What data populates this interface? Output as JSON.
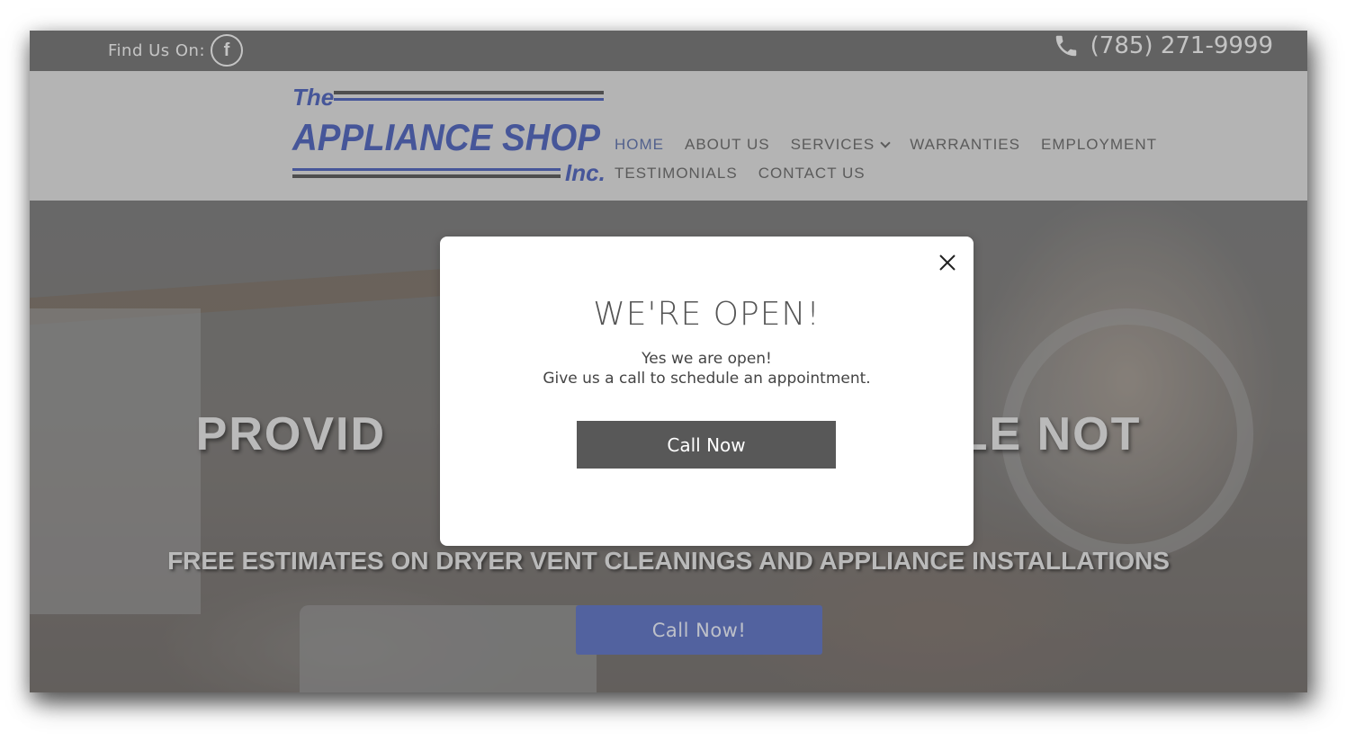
{
  "topbar": {
    "find_us_label": "Find Us On:",
    "facebook_glyph": "f",
    "phone": "(785) 271-9999"
  },
  "logo": {
    "the": "The",
    "main": "APPLIANCE SHOP",
    "inc": "Inc.",
    "color_blue": "#4a5fb8",
    "color_gray": "#555555"
  },
  "nav": {
    "row1": [
      {
        "label": "HOME",
        "active": true
      },
      {
        "label": "ABOUT US"
      },
      {
        "label": "SERVICES",
        "dropdown": true
      },
      {
        "label": "WARRANTIES"
      },
      {
        "label": "EMPLOYMENT"
      }
    ],
    "row2": [
      {
        "label": "TESTIMONIALS"
      },
      {
        "label": "CONTACT US"
      }
    ]
  },
  "hero": {
    "title_left": "PROVID",
    "title_right": "PLE NOT",
    "subtitle": "FREE ESTIMATES ON DRYER VENT CLEANINGS AND APPLIANCE INSTALLATIONS",
    "cta_label": "Call Now!"
  },
  "modal": {
    "title": "WE'RE OPEN!",
    "line1": "Yes we are open!",
    "line2": "Give us a call to schedule an appointment.",
    "cta_label": "Call Now"
  },
  "colors": {
    "accent": "#5a6fc0",
    "nav_active": "#5a6ea8"
  }
}
